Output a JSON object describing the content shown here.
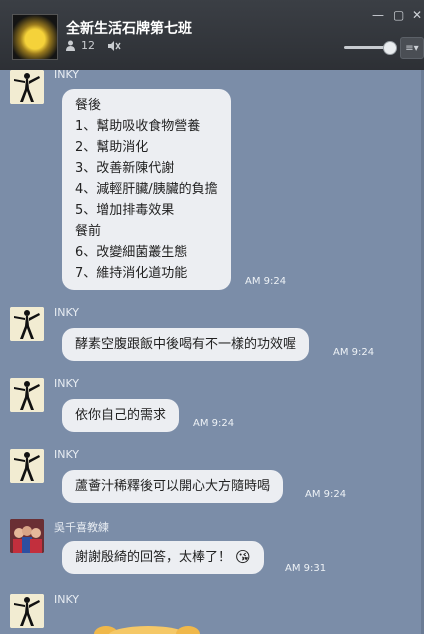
{
  "header": {
    "title": "全新生活石牌第七班",
    "member_count": "12",
    "minimize_icon": "minimize-icon",
    "maximize_icon": "maximize-icon",
    "close_icon": "close-icon"
  },
  "chat": {
    "messages": [
      {
        "sender": "INKY",
        "lines": [
          "餐後",
          "1、幫助吸收食物營養",
          "2、幫助消化",
          "3、改善新陳代謝",
          "4、減輕肝臟/胰臟的負擔",
          "5、增加排毒效果",
          "餐前",
          "6、改變細菌叢生態",
          "7、維持消化道功能"
        ],
        "time": "AM 9:24"
      },
      {
        "sender": "INKY",
        "text": "酵素空腹跟飯中後喝有不一樣的功效喔",
        "time": "AM 9:24"
      },
      {
        "sender": "INKY",
        "text": "依你自己的需求",
        "time": "AM 9:24"
      },
      {
        "sender": "INKY",
        "text": "蘆薈汁稀釋後可以開心大方隨時喝",
        "time": "AM 9:24"
      },
      {
        "sender": "吳千喜教練",
        "text": "謝謝殷綺的回答，太棒了！",
        "time": "AM 9:31",
        "emoji": "😘"
      },
      {
        "sender": "INKY"
      }
    ]
  }
}
